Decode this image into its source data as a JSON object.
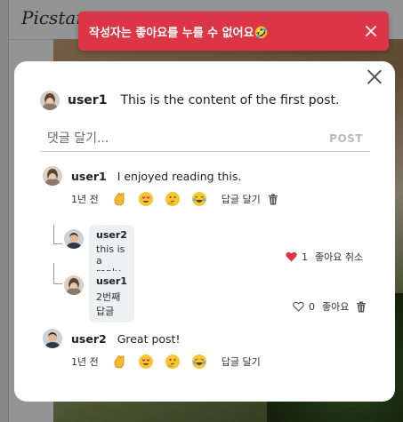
{
  "app": {
    "logo": "Picstary"
  },
  "toast": {
    "message": "작성자는 좋아요를 누를 수 없어요🤣",
    "color": "#dc3545"
  },
  "post": {
    "username": "user1",
    "content": "This is the content of the first post."
  },
  "comment_input": {
    "placeholder": "댓글 달기...",
    "post_label": "POST"
  },
  "comments": [
    {
      "username": "user1",
      "text": "I enjoyed reading this.",
      "time": "1년 전",
      "reply_label": "답글 달기",
      "reactions": [
        "clap-emoji",
        "heart-eyes-emoji",
        "thinking-emoji",
        "laughing-emoji"
      ],
      "replies": [
        {
          "username": "user2",
          "text": "this is a reply",
          "likes": "1",
          "like_label": "좋아요 취소",
          "liked": true
        },
        {
          "username": "user1",
          "text": "2번째 답글",
          "likes": "0",
          "like_label": "좋아요",
          "liked": false
        }
      ]
    },
    {
      "username": "user2",
      "text": "Great post!",
      "time": "1년 전",
      "reply_label": "답글 달기",
      "reactions": [
        "clap-emoji",
        "heart-eyes-emoji",
        "thinking-emoji",
        "laughing-emoji"
      ]
    }
  ],
  "colors": {
    "liked_heart": "#dc3545",
    "bubble": "#eef0f2"
  }
}
